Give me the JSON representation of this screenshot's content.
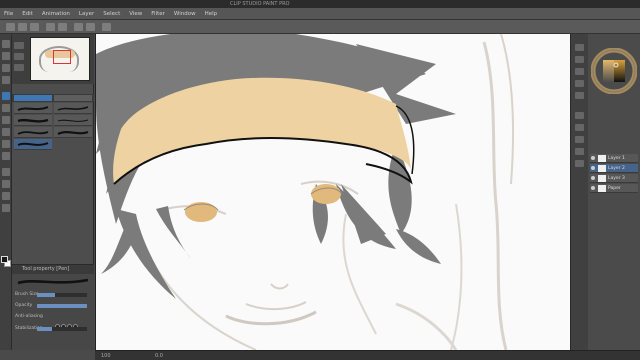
{
  "window": {
    "title": "CLIP STUDIO PAINT PRO"
  },
  "menu": [
    "File",
    "Edit",
    "Animation",
    "Layer",
    "Select",
    "View",
    "Filter",
    "Window",
    "Help"
  ],
  "tool_properties": {
    "header": "Tool property [Pen]",
    "rows": [
      {
        "label": "Brush Size",
        "value": 0.35
      },
      {
        "label": "Opacity",
        "value": 1.0
      },
      {
        "label": "Anti-aliasing",
        "value": 0.5
      },
      {
        "label": "Stabilization",
        "value": 0.3
      }
    ]
  },
  "layers": [
    "Layer 1",
    "Layer 2",
    "Layer 3",
    "Paper"
  ],
  "status": {
    "zoom": "100",
    "angle": "0.0"
  },
  "colors": {
    "hair": "#7b7b7b",
    "headband": "#efd2a2",
    "eyes": "#e1b97c",
    "sketch": "#d8d3cc",
    "accent": "#3f77b3"
  }
}
